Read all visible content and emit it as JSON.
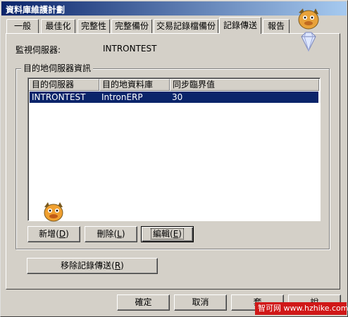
{
  "window": {
    "title": "資料庫維護計劃"
  },
  "tabs": [
    {
      "label": "一般"
    },
    {
      "label": "最佳化"
    },
    {
      "label": "完整性"
    },
    {
      "label": "完整備份"
    },
    {
      "label": "交易記錄檔備份"
    },
    {
      "label": "記錄傳送",
      "active": true
    },
    {
      "label": "報告"
    }
  ],
  "monitor": {
    "label": "監視伺服器:",
    "value": "INTRONTEST"
  },
  "destination_group": {
    "title": "目的地伺服器資訊",
    "columns": [
      "目的伺服器",
      "目的地資料庫",
      "同步臨界值"
    ],
    "rows": [
      {
        "server": "INTRONTEST",
        "database": "IntronERP",
        "threshold": "30",
        "selected": true
      }
    ],
    "buttons": {
      "add": {
        "text": "新增",
        "key": "D"
      },
      "delete": {
        "text": "刪除",
        "key": "L"
      },
      "edit": {
        "text": "編輯",
        "key": "E"
      }
    }
  },
  "remove_log_shipping": {
    "text": "移除記錄傳送",
    "key": "R"
  },
  "dialog_buttons": {
    "ok": "確定",
    "cancel": "取消",
    "apply": "套",
    "help": "說"
  },
  "watermark": {
    "text": "智可网 www.hzhike.com"
  },
  "colors": {
    "selection": "#0a246a",
    "face": "#d4d0c8",
    "title_start": "#0a246a",
    "title_end": "#a6caf0",
    "watermark_bg": "#d01818"
  }
}
